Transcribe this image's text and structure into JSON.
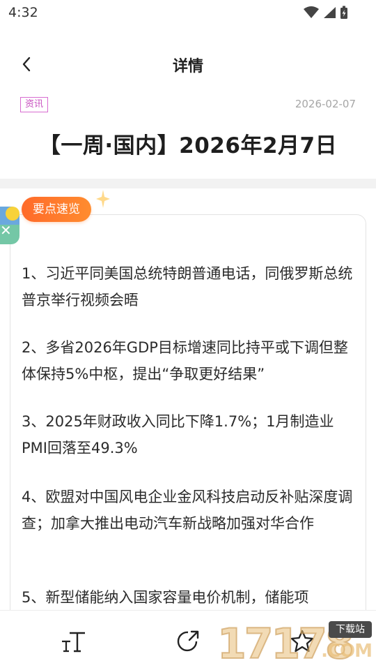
{
  "status_bar": {
    "time": "4:32"
  },
  "nav": {
    "title": "详情"
  },
  "article": {
    "tag": "资讯",
    "date": "2026-02-07",
    "title": "【一周·国内】2026年2月7日"
  },
  "summary": {
    "label": "要点速览",
    "points": [
      "1、习近平同美国总统特朗普通电话，同俄罗斯总统普京举行视频会晤",
      "2、多省2026年GDP目标增速同比持平或下调但整体保持5%中枢，提出“争取更好结果”",
      "3、2025年财政收入同比下降1.7%；1月制造业PMI回落至49.3%",
      "4、欧盟对中国风电企业金风科技启动反补贴深度调查；加拿大推出电动汽车新战略加强对华合作",
      "5、新型储能纳入国家容量电价机制，储能项"
    ]
  },
  "bottom_bar": {
    "font_icon": "font-size-icon",
    "share_icon": "share-icon",
    "favorite_icon": "star-icon"
  },
  "watermark": {
    "number": "17178",
    "site": "下载站",
    "domain": ".COM"
  },
  "colors": {
    "accent": "#ff7a2d",
    "tag": "#c74fbf"
  }
}
